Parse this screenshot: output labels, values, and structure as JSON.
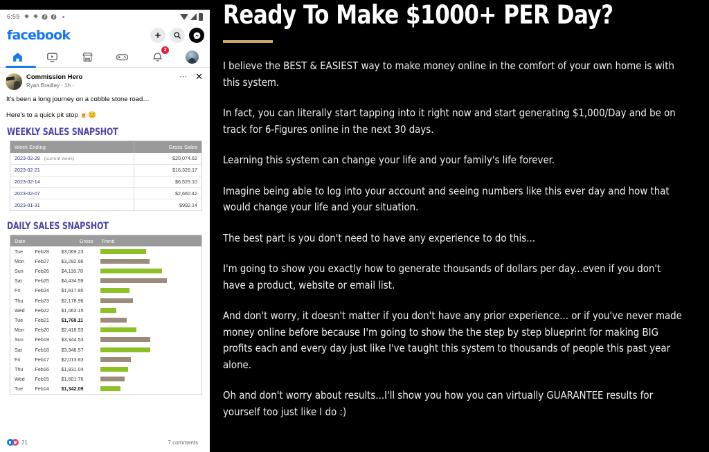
{
  "phone": {
    "status_bar": {
      "time": "6:59",
      "icons": [
        "app-icon",
        "app-icon",
        "facebook-icon",
        "facebook-icon",
        "dot-icon"
      ],
      "right_icons": [
        "wifi-icon",
        "signal-icon",
        "battery-icon"
      ]
    },
    "header": {
      "logo": "facebook",
      "actions": [
        {
          "icon": "plus-icon",
          "glyph": "+"
        },
        {
          "icon": "search-icon",
          "glyph": "⌕"
        },
        {
          "icon": "messenger-icon",
          "glyph": "✉"
        }
      ]
    },
    "nav": {
      "tabs": [
        {
          "name": "home",
          "icon": "home-icon",
          "active": true
        },
        {
          "name": "video",
          "icon": "video-icon",
          "active": false
        },
        {
          "name": "marketplace",
          "icon": "marketplace-icon",
          "active": false
        },
        {
          "name": "gaming",
          "icon": "gaming-icon",
          "active": false
        },
        {
          "name": "notifications",
          "icon": "bell-icon",
          "active": false,
          "badge": "2"
        },
        {
          "name": "profile",
          "icon": "avatar-icon",
          "active": false
        }
      ]
    },
    "post": {
      "page_name": "Commission Hero",
      "author": "Ryan Bradley · 1h ·",
      "menu_icon": "more-options-icon",
      "close_icon": "close-icon",
      "lines": [
        "It's been a long journey on a cobble stone road…",
        "Here's to a quick pit stop 🍺😊"
      ],
      "footer": {
        "reaction_count": "21",
        "comments": "7 comments"
      }
    },
    "weekly": {
      "title": "WEEKLY SALES SNAPSHOT",
      "headers": [
        "Week Ending",
        "Gross Sales"
      ],
      "rows": [
        {
          "date": "2023-02-28",
          "note": "(current week)",
          "amount": "$20,074.62"
        },
        {
          "date": "2023-02-21",
          "note": "",
          "amount": "$16,326.17"
        },
        {
          "date": "2023-02-14",
          "note": "",
          "amount": "$6,525.10"
        },
        {
          "date": "2023-02-07",
          "note": "",
          "amount": "$2,660.42"
        },
        {
          "date": "2023-01-31",
          "note": "",
          "amount": "$992.14"
        }
      ]
    },
    "daily": {
      "title": "DAILY SALES SNAPSHOT",
      "headers": [
        "Date",
        "Gross",
        "Trend"
      ],
      "colors": {
        "green": "#8CC024",
        "taupe": "#9C8B7D"
      },
      "rows": [
        {
          "dow": "Tue",
          "day": "Feb28",
          "amount": "$3,069.23",
          "bold": false,
          "value": 3069.23,
          "color": "green"
        },
        {
          "dow": "Mon",
          "day": "Feb27",
          "amount": "$3,292.96",
          "bold": false,
          "value": 3292.96,
          "color": "taupe"
        },
        {
          "dow": "Sun",
          "day": "Feb26",
          "amount": "$4,118.78",
          "bold": false,
          "value": 4118.78,
          "color": "green"
        },
        {
          "dow": "Sat",
          "day": "Feb25",
          "amount": "$4,434.59",
          "bold": false,
          "value": 4434.59,
          "color": "taupe"
        },
        {
          "dow": "Fri",
          "day": "Feb24",
          "amount": "$1,917.95",
          "bold": false,
          "value": 1917.95,
          "color": "green"
        },
        {
          "dow": "Thu",
          "day": "Feb23",
          "amount": "$2,178.96",
          "bold": false,
          "value": 2178.96,
          "color": "taupe"
        },
        {
          "dow": "Wed",
          "day": "Feb22",
          "amount": "$1,062.15",
          "bold": false,
          "value": 1062.15,
          "color": "green"
        },
        {
          "dow": "Tue",
          "day": "Feb21",
          "amount": "$1,768.11",
          "bold": true,
          "value": 1768.11,
          "color": "taupe"
        },
        {
          "dow": "Mon",
          "day": "Feb20",
          "amount": "$2,418.53",
          "bold": false,
          "value": 2418.53,
          "color": "green"
        },
        {
          "dow": "Sun",
          "day": "Feb19",
          "amount": "$3,344.53",
          "bold": false,
          "value": 3344.53,
          "color": "taupe"
        },
        {
          "dow": "Sat",
          "day": "Feb18",
          "amount": "$3,348.57",
          "bold": false,
          "value": 3348.57,
          "color": "green"
        },
        {
          "dow": "Fri",
          "day": "Feb17",
          "amount": "$2,013.63",
          "bold": false,
          "value": 2013.63,
          "color": "taupe"
        },
        {
          "dow": "Thu",
          "day": "Feb16",
          "amount": "$1,831.04",
          "bold": false,
          "value": 1831.04,
          "color": "green"
        },
        {
          "dow": "Wed",
          "day": "Feb15",
          "amount": "$1,601.76",
          "bold": false,
          "value": 1601.76,
          "color": "taupe"
        },
        {
          "dow": "Tue",
          "day": "Feb14",
          "amount": "$1,342.09",
          "bold": true,
          "value": 1342.09,
          "color": "green"
        }
      ]
    }
  },
  "copy": {
    "headline": "Ready To Make $1000+ PER Day?",
    "accent_color": "#C9A96A",
    "paragraphs": [
      "I believe the BEST & EASIEST way to make money online in the comfort of your own home is with this system.",
      "In fact, you can literally start tapping into it right now and start generating $1,000/Day and be on track for 6-Figures online in the next 30 days.",
      "Learning this system can change your life and your family's life forever.",
      "Imagine being able to log into your account and seeing numbers like this ever day and how that would change your life and your situation.",
      "The best part is you don't need to have any experience to do this...",
      "I'm going to show you exactly how to generate thousands of dollars per day...even if you don't have a product, website or email list.",
      "And don't worry, it doesn't matter if you don't have any prior experience... or if you've never made money online before because I'm going to show the the step by step blueprint for making BIG profits each and every day just like I've taught this system to thousands of people this past year alone.",
      "Oh and don't worry about results...I'll show you how you can virtually GUARANTEE results for yourself too just like I do :)"
    ]
  }
}
